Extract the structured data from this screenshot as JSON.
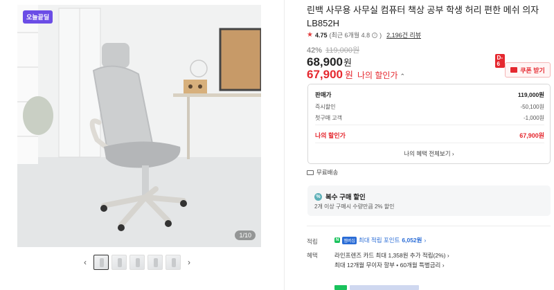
{
  "gallery": {
    "badge": "오늘끝딜",
    "counter": "1/10",
    "thumb_count": 5,
    "prev_arrow": "‹",
    "next_arrow": "›"
  },
  "product": {
    "title": "린백 사무용 사무실 컴퓨터 책상 공부 학생 허리 편한 메쉬 의자 LB852H",
    "rating": "4.75",
    "rating_detail": "(최근 6개월 4.8",
    "reviews": "2,196건 리뷰",
    "discount_pct": "42%",
    "original_price": "119,000원",
    "price": "68,900",
    "price_unit": "원",
    "my_price": "67,900",
    "my_price_unit": "원",
    "my_price_label": "나의 할인가",
    "coupon": {
      "dday": "D-6",
      "label": "쿠폰 받기"
    }
  },
  "benefits": {
    "rows": [
      {
        "label": "판매가",
        "value": "119,000원"
      },
      {
        "label": "즉시할인",
        "value": "-50,100원"
      },
      {
        "label": "첫구매 고객",
        "value": "-1,000원"
      }
    ],
    "mine": {
      "label": "나의 할인가",
      "value": "67,900원"
    },
    "all_link": "나의 혜택 전체보기"
  },
  "shipping": {
    "label": "무료배송"
  },
  "multi_buy": {
    "title": "복수 구매 할인",
    "desc": "2개 이상 구매시 수량만큼 2% 할인"
  },
  "points": {
    "label": "적립",
    "npay": "N",
    "npay_plus": "멤버십",
    "text": "최대 적립 포인트",
    "amount": "6,052원"
  },
  "perks": {
    "label": "혜택",
    "line1": "라인프렌즈 카드 최대 1,358원 추가 적립(2%)",
    "line2": "최대 12개월 무이자 할부 • 60개월 특별금리"
  },
  "colors": {
    "accent_red": "#e5282f",
    "link_blue": "#2a6cd6",
    "badge_purple": "#6b4de6"
  }
}
